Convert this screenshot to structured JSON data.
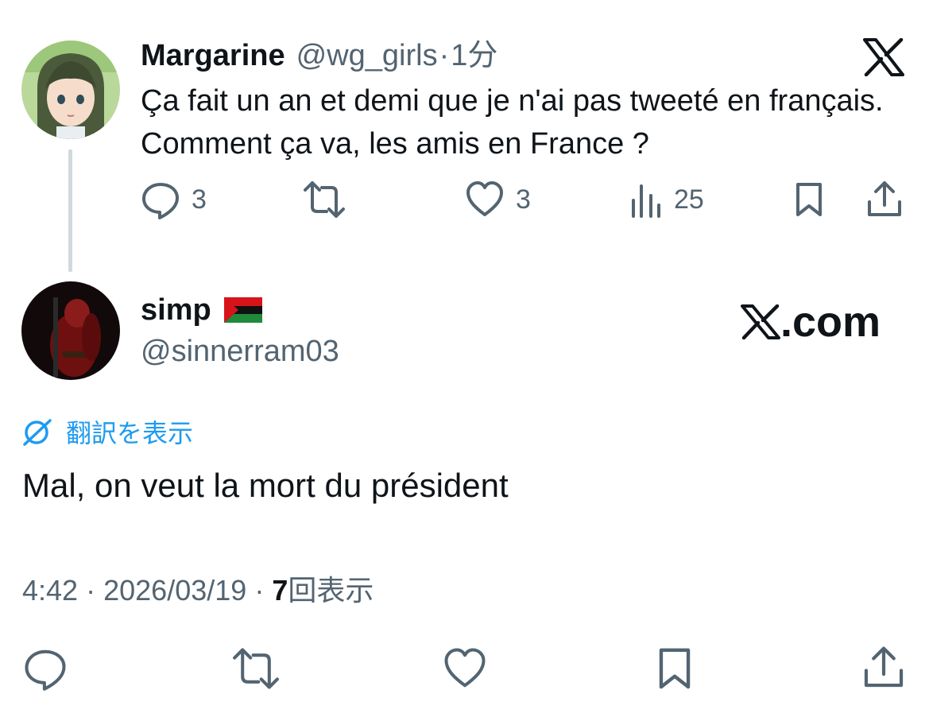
{
  "parent_tweet": {
    "display_name": "Margarine",
    "handle": "@wg_girls",
    "separator": "·",
    "time": "1分",
    "text": "Ça fait un an et demi que je n'ai pas tweeté en français. Comment ça va, les amis en France ?",
    "actions": {
      "reply_count": "3",
      "like_count": "3",
      "views_count": "25"
    },
    "avatar_icon": "anime-girl-avatar"
  },
  "brand": {
    "logo_icon": "x-logo-icon",
    "watermark_suffix": ".com"
  },
  "reply_tweet": {
    "display_name": "simp",
    "flag_icon": "red-black-green-flag-icon",
    "handle": "@sinnerram03",
    "translate_label": "翻訳を表示",
    "text": "Mal, on veut la mort du président",
    "meta": {
      "time": "4:42",
      "dot1": "·",
      "date": "2026/03/19",
      "dot2": "·",
      "views_count": "7",
      "views_label": "回表示"
    },
    "avatar_icon": "dark-red-figure-avatar"
  },
  "colors": {
    "text_primary": "#0f1419",
    "text_secondary": "#536471",
    "link_blue": "#1d9bf0",
    "thread_line": "#cfd9de"
  }
}
